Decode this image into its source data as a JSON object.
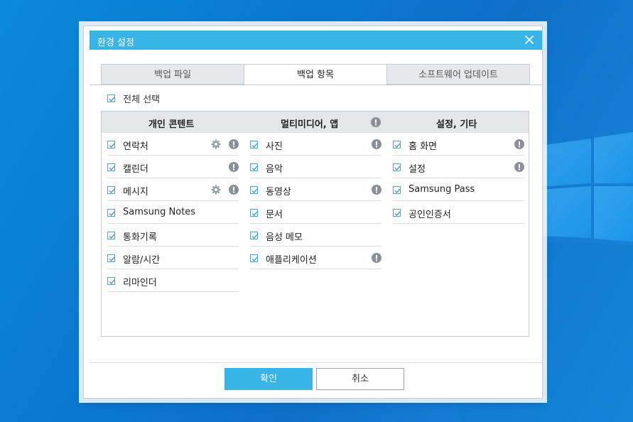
{
  "dialog": {
    "title": "환경 설정",
    "tabs": [
      {
        "label": "백업 파일",
        "active": false
      },
      {
        "label": "백업 항목",
        "active": true
      },
      {
        "label": "소프트웨어 업데이트",
        "active": false
      }
    ],
    "select_all": {
      "label": "전체 선택",
      "checked": true
    },
    "columns": [
      {
        "header": "개인 콘텐트",
        "info_icon": false,
        "items": [
          {
            "label": "연락처",
            "checked": true,
            "settings_icon": true,
            "info_icon": true
          },
          {
            "label": "캘린더",
            "checked": true,
            "settings_icon": false,
            "info_icon": true
          },
          {
            "label": "메시지",
            "checked": true,
            "settings_icon": true,
            "info_icon": true
          },
          {
            "label": "Samsung Notes",
            "checked": true,
            "settings_icon": false,
            "info_icon": false
          },
          {
            "label": "통화기록",
            "checked": true,
            "settings_icon": false,
            "info_icon": false
          },
          {
            "label": "알람/시간",
            "checked": true,
            "settings_icon": false,
            "info_icon": false
          },
          {
            "label": "리마인더",
            "checked": true,
            "settings_icon": false,
            "info_icon": false
          }
        ]
      },
      {
        "header": "멀티미디어, 앱",
        "info_icon": true,
        "items": [
          {
            "label": "사진",
            "checked": true,
            "settings_icon": false,
            "info_icon": true
          },
          {
            "label": "음악",
            "checked": true,
            "settings_icon": false,
            "info_icon": false
          },
          {
            "label": "동영상",
            "checked": true,
            "settings_icon": false,
            "info_icon": true
          },
          {
            "label": "문서",
            "checked": true,
            "settings_icon": false,
            "info_icon": false
          },
          {
            "label": "음성 메모",
            "checked": true,
            "settings_icon": false,
            "info_icon": false
          },
          {
            "label": "애플리케이션",
            "checked": true,
            "settings_icon": false,
            "info_icon": true
          }
        ]
      },
      {
        "header": "설정, 기타",
        "info_icon": false,
        "items": [
          {
            "label": "홈 화면",
            "checked": true,
            "settings_icon": false,
            "info_icon": true
          },
          {
            "label": "설정",
            "checked": true,
            "settings_icon": false,
            "info_icon": true
          },
          {
            "label": "Samsung Pass",
            "checked": true,
            "settings_icon": false,
            "info_icon": false
          },
          {
            "label": "공인인증서",
            "checked": true,
            "settings_icon": false,
            "info_icon": false
          }
        ]
      }
    ],
    "buttons": {
      "ok": "확인",
      "cancel": "취소"
    },
    "colors": {
      "accent": "#39b4e6",
      "check": "#4aa3cf",
      "header_bg": "#e4e6ea",
      "icon": "#8a9099"
    }
  }
}
